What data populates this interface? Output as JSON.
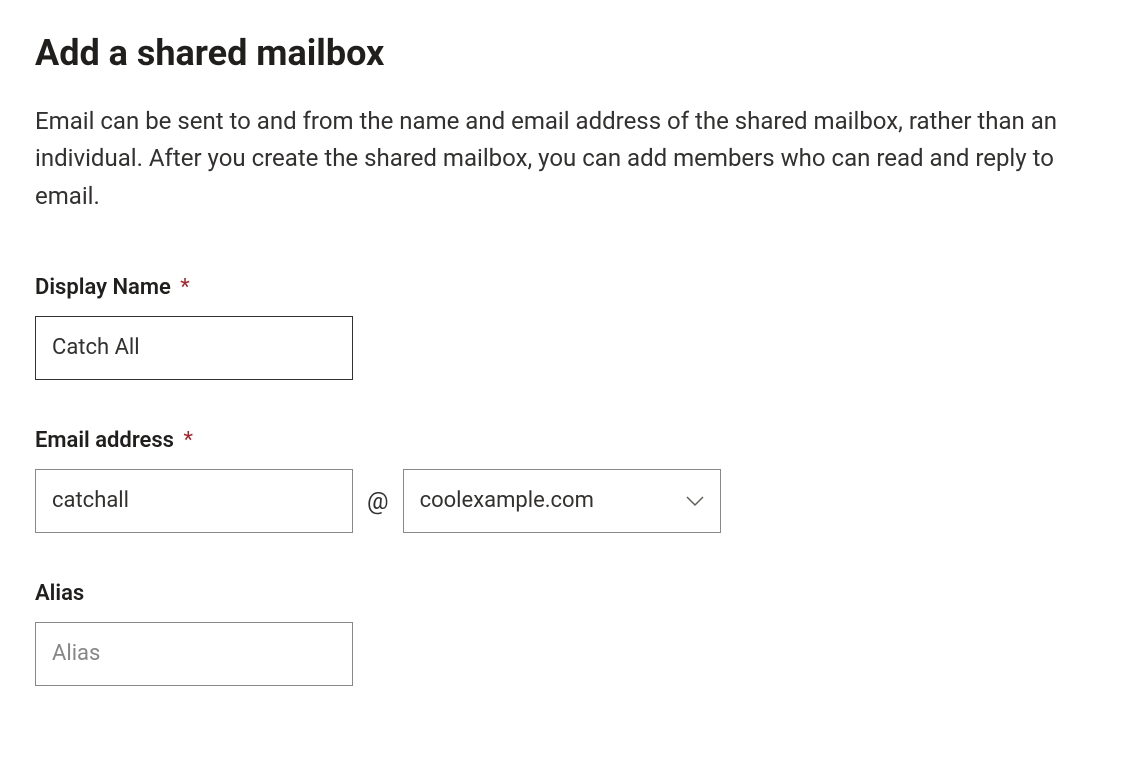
{
  "title": "Add a shared mailbox",
  "description": "Email can be sent to and from the name and email address of the shared mailbox, rather than an individual. After you create the shared mailbox, you can add members who can read and reply to email.",
  "required_mark": "*",
  "fields": {
    "display_name": {
      "label": "Display Name",
      "required": true,
      "value": "Catch All"
    },
    "email_address": {
      "label": "Email address",
      "required": true,
      "local_value": "catchall",
      "at": "@",
      "domain_value": "coolexample.com"
    },
    "alias": {
      "label": "Alias",
      "required": false,
      "value": "",
      "placeholder": "Alias"
    }
  }
}
